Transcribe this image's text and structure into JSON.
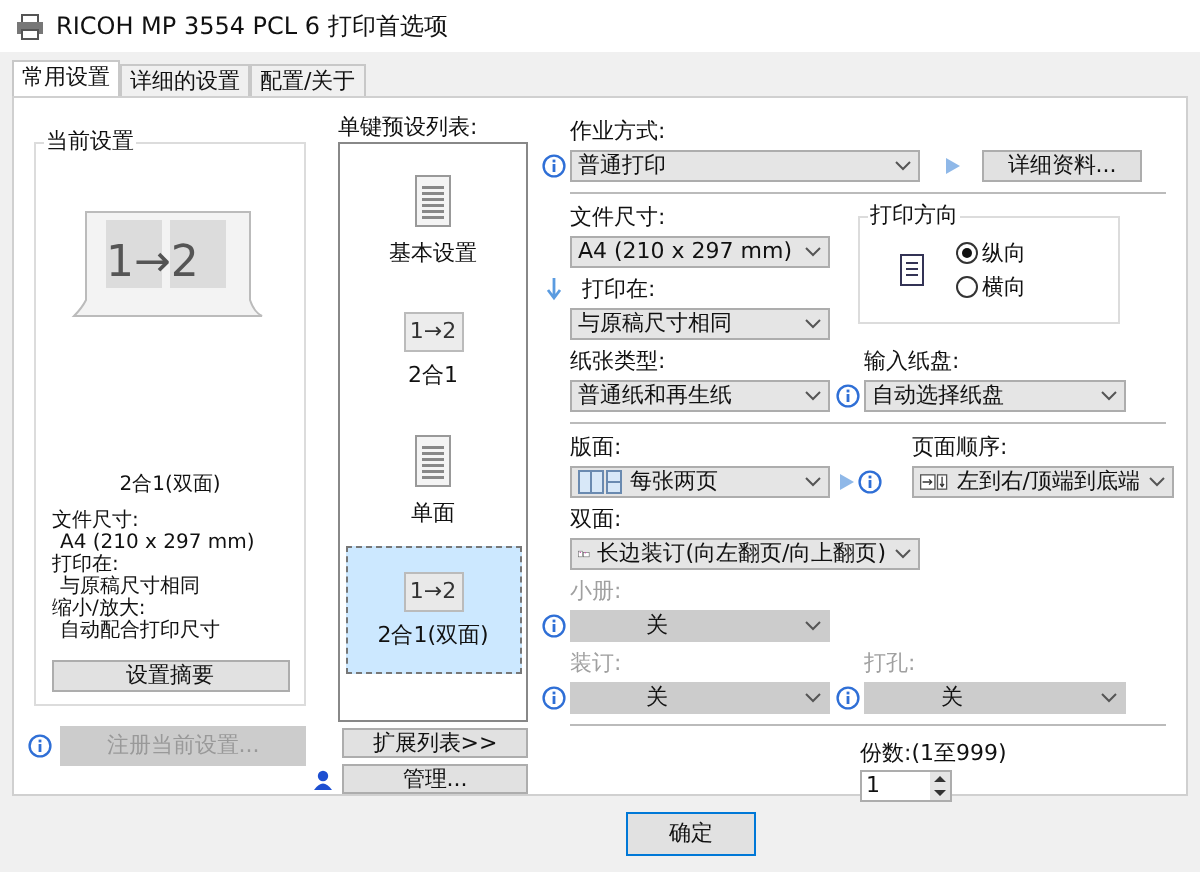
{
  "window": {
    "title": "RICOH MP 3554 PCL 6 打印首选项"
  },
  "tabs": [
    {
      "label": "常用设置",
      "selected": true
    },
    {
      "label": "详细的设置",
      "selected": false
    },
    {
      "label": "配置/关于",
      "selected": false
    }
  ],
  "current_settings": {
    "title": "当前设置",
    "preview_label": "1→2",
    "caption": "2合1(双面)",
    "details": [
      {
        "label": "文件尺寸:",
        "value": "A4 (210 x 297 mm)"
      },
      {
        "label": "打印在:",
        "value": "与原稿尺寸相同"
      },
      {
        "label": "缩小/放大:",
        "value": "自动配合打印尺寸"
      }
    ],
    "summary_button": "设置摘要"
  },
  "register_button": {
    "label": "注册当前设置...",
    "disabled": true
  },
  "presets": {
    "title": "单键预设列表:",
    "items": [
      {
        "label": "基本设置",
        "kind": "document",
        "selected": false
      },
      {
        "label": "2合1",
        "kind": "combine",
        "icon_label": "1→2",
        "selected": false
      },
      {
        "label": "单面",
        "kind": "document",
        "selected": false
      },
      {
        "label": "2合1(双面)",
        "kind": "combine",
        "icon_label": "1→2",
        "selected": true
      }
    ]
  },
  "expand_button": "扩展列表>>",
  "manage_button": "管理...",
  "job_type": {
    "label": "作业方式:",
    "value": "普通打印",
    "button": "详细资料..."
  },
  "document_size": {
    "label": "文件尺寸:",
    "value": "A4 (210 x 297 mm)"
  },
  "print_on": {
    "label": "打印在:",
    "value": "与原稿尺寸相同"
  },
  "orientation": {
    "title": "打印方向",
    "options": [
      {
        "label": "纵向",
        "selected": true
      },
      {
        "label": "横向",
        "selected": false
      }
    ]
  },
  "paper_type": {
    "label": "纸张类型:",
    "value": "普通纸和再生纸"
  },
  "input_tray": {
    "label": "输入纸盘:",
    "value": "自动选择纸盘"
  },
  "layout": {
    "label": "版面:",
    "value": "每张两页"
  },
  "page_order": {
    "label": "页面顺序:",
    "value": "左到右/顶端到底端"
  },
  "duplex": {
    "label": "双面:",
    "value": "长边装订(向左翻页/向上翻页)"
  },
  "booklet": {
    "label": "小册:",
    "value": "关",
    "disabled": true
  },
  "staple": {
    "label": "装订:",
    "value": "关",
    "disabled": true
  },
  "punch": {
    "label": "打孔:",
    "value": "关",
    "disabled": true
  },
  "copies": {
    "label": "份数:(1至999)",
    "value": "1"
  },
  "buttons": [
    "确定"
  ]
}
